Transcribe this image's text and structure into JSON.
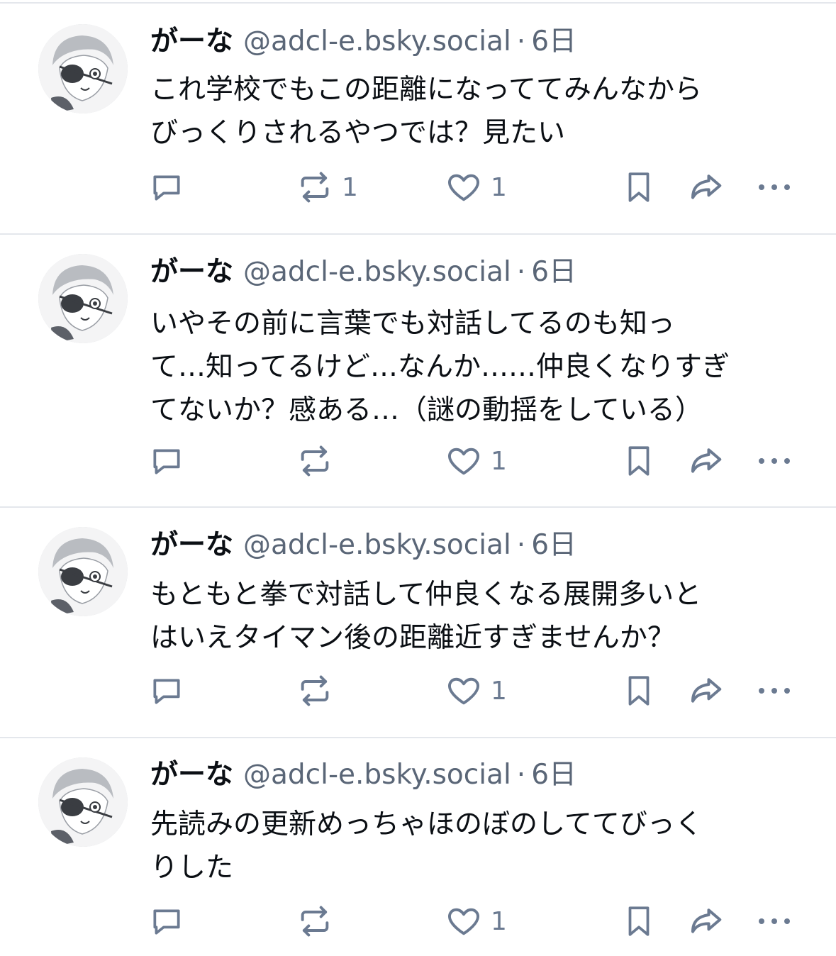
{
  "colors": {
    "text": "#0b0f14",
    "muted": "#5a6677",
    "icon": "#6b7a91",
    "divider": "#e4e7ec"
  },
  "posts": [
    {
      "display_name": "がーな",
      "handle": "@adcl-e.bsky.social",
      "separator": "·",
      "time": "6日",
      "text": "これ学校でもこの距離になっててみんなから\nびっくりされるやつでは？見たい",
      "counts": {
        "reply": "",
        "repost": "1",
        "like": "1"
      }
    },
    {
      "display_name": "がーな",
      "handle": "@adcl-e.bsky.social",
      "separator": "·",
      "time": "6日",
      "text": "いやその前に言葉でも対話してるのも知っ\nて…知ってるけど…なんか……仲良くなりすぎ\nてないか？感ある…（謎の動揺をしている）",
      "counts": {
        "reply": "",
        "repost": "",
        "like": "1"
      }
    },
    {
      "display_name": "がーな",
      "handle": "@adcl-e.bsky.social",
      "separator": "·",
      "time": "6日",
      "text": "もともと拳で対話して仲良くなる展開多いと\nはいえタイマン後の距離近すぎませんか？",
      "counts": {
        "reply": "",
        "repost": "",
        "like": "1"
      }
    },
    {
      "display_name": "がーな",
      "handle": "@adcl-e.bsky.social",
      "separator": "·",
      "time": "6日",
      "text": "先読みの更新めっちゃほのぼのしててびっく\nりした",
      "counts": {
        "reply": "",
        "repost": "",
        "like": "1"
      }
    }
  ],
  "icons": {
    "avatar": "avatar-illustration",
    "reply": "reply-bubble-icon",
    "repost": "repost-arrows-icon",
    "like": "heart-icon",
    "bookmark": "bookmark-icon",
    "share": "share-arrow-icon",
    "more": "more-ellipsis-icon"
  }
}
